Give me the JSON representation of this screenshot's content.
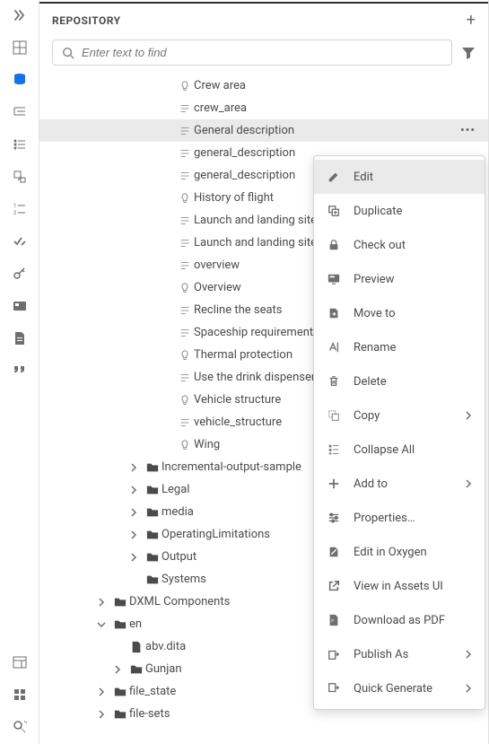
{
  "panel": {
    "title": "REPOSITORY"
  },
  "search": {
    "placeholder": "Enter text to find"
  },
  "tree": {
    "items": [
      {
        "depth": 4,
        "icon": "bulb",
        "label": "Crew area"
      },
      {
        "depth": 4,
        "icon": "topic",
        "label": "crew_area"
      },
      {
        "depth": 4,
        "icon": "topic",
        "label": "General description",
        "selected": true,
        "more": true
      },
      {
        "depth": 4,
        "icon": "topic",
        "label": "general_description"
      },
      {
        "depth": 4,
        "icon": "topic",
        "label": "general_description"
      },
      {
        "depth": 4,
        "icon": "bulb",
        "label": "History of flight"
      },
      {
        "depth": 4,
        "icon": "topic",
        "label": "Launch and landing site"
      },
      {
        "depth": 4,
        "icon": "topic",
        "label": "Launch and landing site"
      },
      {
        "depth": 4,
        "icon": "topic",
        "label": "overview"
      },
      {
        "depth": 4,
        "icon": "bulb",
        "label": "Overview"
      },
      {
        "depth": 4,
        "icon": "topic",
        "label": "Recline the seats"
      },
      {
        "depth": 4,
        "icon": "topic",
        "label": "Spaceship requirements"
      },
      {
        "depth": 4,
        "icon": "bulb",
        "label": "Thermal protection"
      },
      {
        "depth": 4,
        "icon": "topic",
        "label": "Use the drink dispenser"
      },
      {
        "depth": 4,
        "icon": "bulb",
        "label": "Vehicle structure"
      },
      {
        "depth": 4,
        "icon": "topic",
        "label": "vehicle_structure"
      },
      {
        "depth": 4,
        "icon": "bulb",
        "label": "Wing"
      },
      {
        "depth": 2,
        "icon": "folder",
        "label": "Incremental-output-sample",
        "chevron": "right"
      },
      {
        "depth": 2,
        "icon": "folder",
        "label": "Legal",
        "chevron": "right"
      },
      {
        "depth": 2,
        "icon": "folder",
        "label": "media",
        "chevron": "right"
      },
      {
        "depth": 2,
        "icon": "folder",
        "label": "OperatingLimitations",
        "chevron": "right"
      },
      {
        "depth": 2,
        "icon": "folder",
        "label": "Output",
        "chevron": "right"
      },
      {
        "depth": 2,
        "icon": "folder",
        "label": "Systems"
      },
      {
        "depth": 0,
        "icon": "folder",
        "label": "DXML Components",
        "chevron": "right"
      },
      {
        "depth": 0,
        "icon": "folder",
        "label": "en",
        "chevron": "down"
      },
      {
        "depth": 1,
        "icon": "file",
        "label": "abv.dita"
      },
      {
        "depth": 1,
        "icon": "folder",
        "label": "Gunjan",
        "chevron": "right"
      },
      {
        "depth": 0,
        "icon": "folder",
        "label": "file_state",
        "chevron": "right"
      },
      {
        "depth": 0,
        "icon": "folder",
        "label": "file-sets",
        "chevron": "right"
      }
    ]
  },
  "menu": {
    "items": [
      {
        "icon": "edit",
        "label": "Edit",
        "highlighted": true
      },
      {
        "icon": "duplicate",
        "label": "Duplicate"
      },
      {
        "icon": "lock",
        "label": "Check out"
      },
      {
        "icon": "preview",
        "label": "Preview"
      },
      {
        "icon": "moveto",
        "label": "Move to"
      },
      {
        "icon": "rename",
        "label": "Rename"
      },
      {
        "icon": "delete",
        "label": "Delete"
      },
      {
        "icon": "copy",
        "label": "Copy",
        "arrow": true
      },
      {
        "icon": "collapse",
        "label": "Collapse All"
      },
      {
        "icon": "add",
        "label": "Add to",
        "arrow": true
      },
      {
        "icon": "properties",
        "label": "Properties…"
      },
      {
        "icon": "oxygen",
        "label": "Edit in Oxygen"
      },
      {
        "icon": "external",
        "label": "View in Assets UI"
      },
      {
        "icon": "pdf",
        "label": "Download as PDF"
      },
      {
        "icon": "publish",
        "label": "Publish As",
        "arrow": true
      },
      {
        "icon": "generate",
        "label": "Quick Generate",
        "arrow": true
      }
    ]
  }
}
